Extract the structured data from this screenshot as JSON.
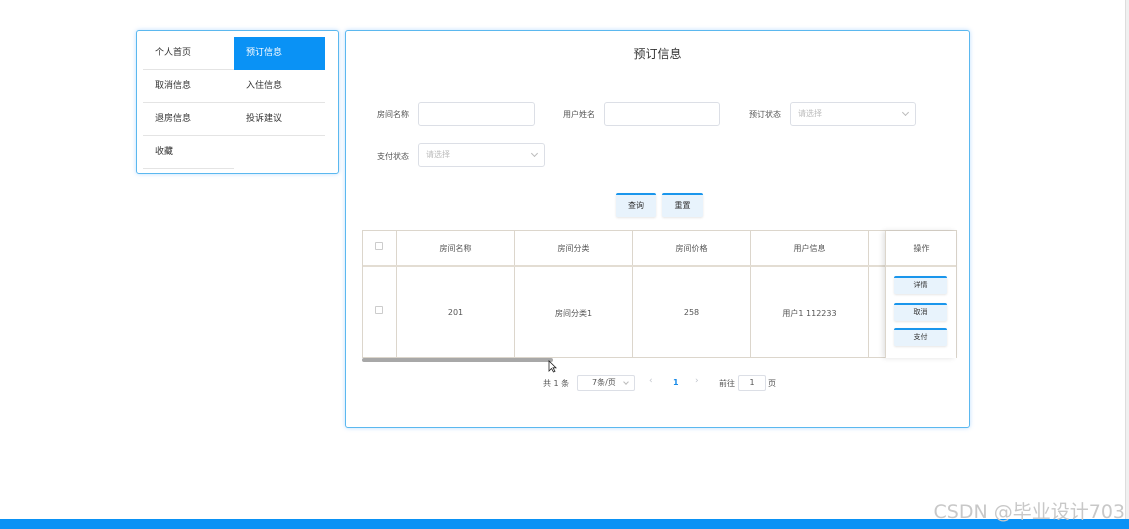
{
  "menu": {
    "items": [
      {
        "label": "个人首页",
        "active": false
      },
      {
        "label": "预订信息",
        "active": true
      },
      {
        "label": "取消信息",
        "active": false
      },
      {
        "label": "入住信息",
        "active": false
      },
      {
        "label": "退房信息",
        "active": false
      },
      {
        "label": "投诉建议",
        "active": false
      },
      {
        "label": "收藏",
        "active": false
      }
    ]
  },
  "panel": {
    "title": "预订信息"
  },
  "search": {
    "room_name_label": "房间名称",
    "room_name_value": "",
    "user_name_label": "用户姓名",
    "user_name_value": "",
    "booking_status_label": "预订状态",
    "booking_status_placeholder": "请选择",
    "payment_status_label": "支付状态",
    "payment_status_placeholder": "请选择",
    "query_button": "查询",
    "reset_button": "重置"
  },
  "table": {
    "headers": [
      "房间名称",
      "房间分类",
      "房间价格",
      "用户信息",
      "操作"
    ],
    "rows": [
      {
        "room_name": "201",
        "category": "房间分类1",
        "price": "258",
        "user_info": "用户1 112233"
      }
    ],
    "actions": [
      "详情",
      "取消",
      "支付"
    ]
  },
  "pagination": {
    "total": "共 1 条",
    "page_size": "7条/页",
    "prev": "‹",
    "current": "1",
    "next": "›",
    "goto_label": "前往",
    "goto_value": "1",
    "page_unit": "页"
  },
  "watermark": "CSDN @毕业设计703",
  "colors": {
    "accent": "#0a92f5",
    "border": "#5bb8ef"
  }
}
